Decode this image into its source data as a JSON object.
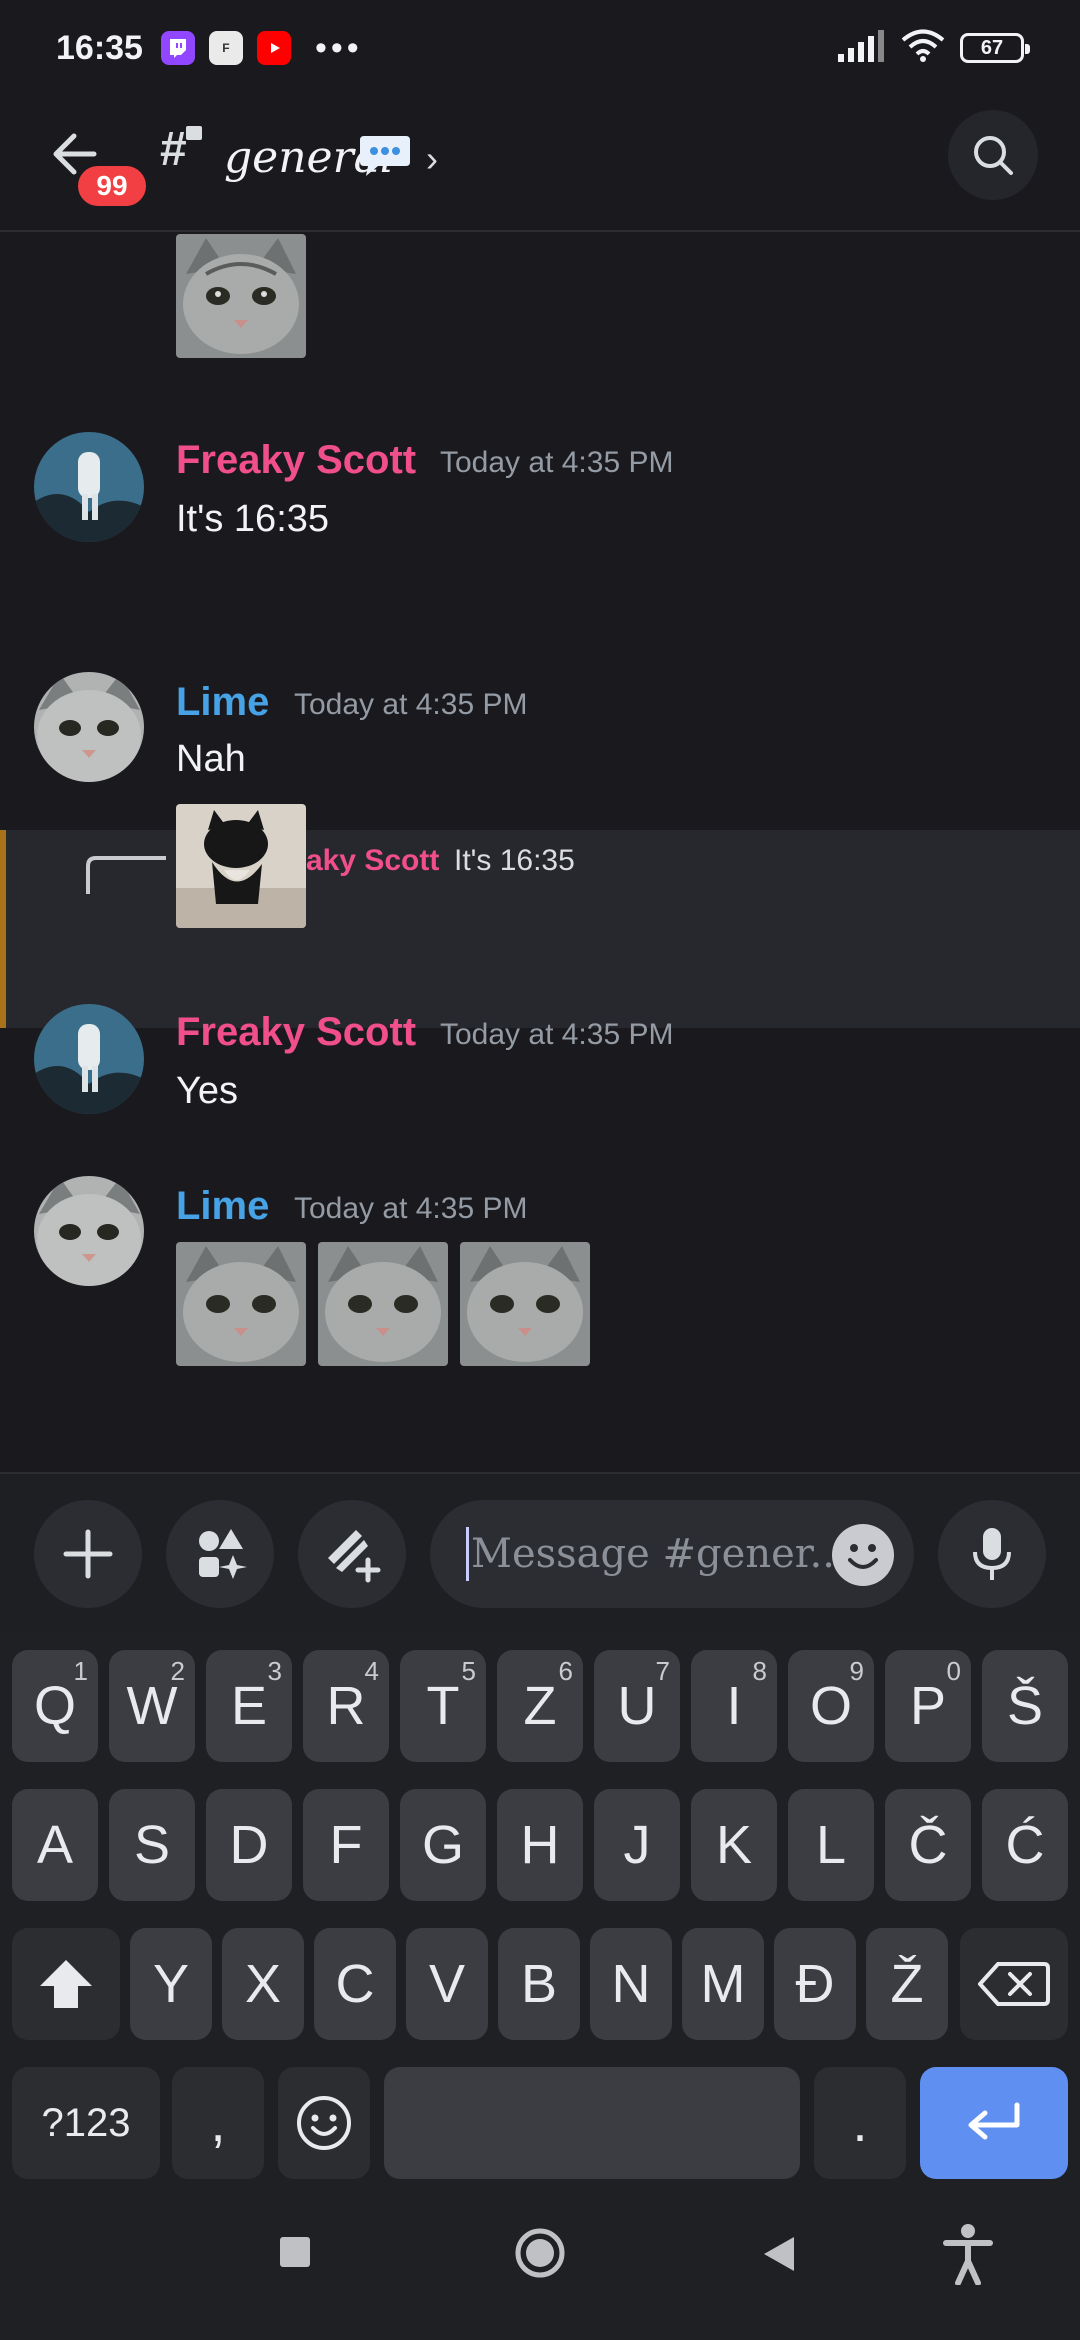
{
  "status_bar": {
    "time": "16:35",
    "app_icons": [
      "twitch-icon",
      "fast-app-icon",
      "youtube-icon"
    ],
    "more": "•••",
    "battery": "67",
    "icons": [
      "signal-icon",
      "wifi-icon",
      "battery-icon"
    ]
  },
  "header": {
    "back_label": "back",
    "unread_count": "99",
    "channel_name": "general",
    "chevron": "›",
    "icons": [
      "back-arrow-icon",
      "hash-lock-icon",
      "speech-bubble-icon",
      "search-icon"
    ]
  },
  "messages": [
    {
      "id": "m0",
      "type": "image",
      "images": 1
    },
    {
      "id": "m1",
      "author": "Freaky Scott",
      "author_color": "#f04f8c",
      "timestamp": "Today at 4:35 PM",
      "text": "It's 16:35"
    },
    {
      "id": "m2",
      "author": "Lime",
      "author_color": "#47a3e6",
      "timestamp": "Today at 4:35 PM",
      "text": "Nah",
      "reply": {
        "mention": "@Freaky Scott",
        "text": "It's 16:35"
      },
      "images": 1
    },
    {
      "id": "m3",
      "author": "Freaky Scott",
      "author_color": "#f04f8c",
      "timestamp": "Today at 4:35 PM",
      "text": "Yes"
    },
    {
      "id": "m4",
      "author": "Lime",
      "author_color": "#47a3e6",
      "timestamp": "Today at 4:35 PM",
      "images": 3
    }
  ],
  "composer": {
    "placeholder": "Message #gener...",
    "icons": [
      "plus-icon",
      "apps-icon",
      "gift-icon",
      "emoji-icon",
      "microphone-icon"
    ]
  },
  "keyboard": {
    "row1": [
      {
        "k": "Q",
        "h": "1"
      },
      {
        "k": "W",
        "h": "2"
      },
      {
        "k": "E",
        "h": "3"
      },
      {
        "k": "R",
        "h": "4"
      },
      {
        "k": "T",
        "h": "5"
      },
      {
        "k": "Z",
        "h": "6"
      },
      {
        "k": "U",
        "h": "7"
      },
      {
        "k": "I",
        "h": "8"
      },
      {
        "k": "O",
        "h": "9"
      },
      {
        "k": "P",
        "h": "0"
      },
      {
        "k": "Š",
        "h": ""
      }
    ],
    "row2": [
      "A",
      "S",
      "D",
      "F",
      "G",
      "H",
      "J",
      "K",
      "L",
      "Č",
      "Ć"
    ],
    "row3": [
      "Y",
      "X",
      "C",
      "V",
      "B",
      "N",
      "M",
      "Đ",
      "Ž"
    ],
    "symbols": "?123",
    "comma": ",",
    "period": ".",
    "icons": [
      "shift-icon",
      "backspace-icon",
      "emoji-icon",
      "enter-icon"
    ]
  },
  "nav": {
    "icons": [
      "recents-icon",
      "home-icon",
      "back-icon",
      "accessibility-icon"
    ]
  },
  "colors": {
    "background": "#1a1a1e",
    "accent_blue": "#5f8ff0",
    "mention_pink": "#f04f8c",
    "lime_blue": "#47a3e6",
    "badge_red": "#f23f43"
  }
}
